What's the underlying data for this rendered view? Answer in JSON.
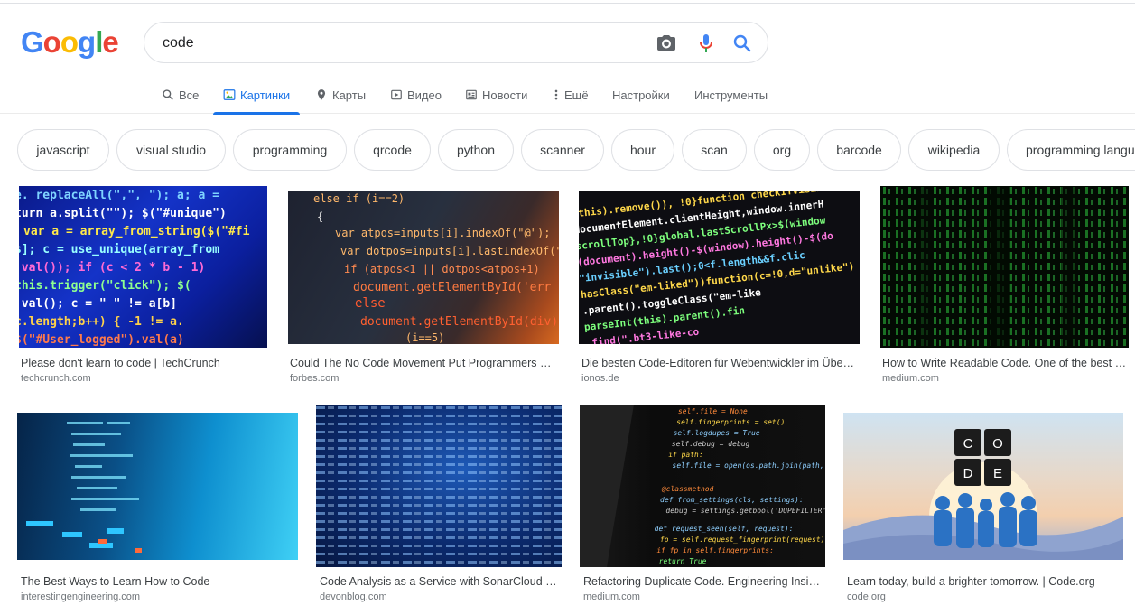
{
  "logo": {
    "letters": [
      "G",
      "o",
      "o",
      "g",
      "l",
      "e"
    ],
    "colors": [
      "#4285F4",
      "#EA4335",
      "#FBBC05",
      "#4285F4",
      "#34A853",
      "#EA4335"
    ]
  },
  "search": {
    "query": "code"
  },
  "tabs": [
    {
      "label": "Все",
      "icon": "search-icon"
    },
    {
      "label": "Картинки",
      "icon": "image-icon",
      "active": true
    },
    {
      "label": "Карты",
      "icon": "map-pin-icon"
    },
    {
      "label": "Видео",
      "icon": "video-icon"
    },
    {
      "label": "Новости",
      "icon": "news-icon"
    },
    {
      "label": "Ещё",
      "icon": "more-vert-icon"
    },
    {
      "label": "Настройки"
    },
    {
      "label": "Инструменты"
    }
  ],
  "chips": [
    "javascript",
    "visual studio",
    "programming",
    "qrcode",
    "python",
    "scanner",
    "hour",
    "scan",
    "org",
    "barcode",
    "wikipedia",
    "programming langu"
  ],
  "results": [
    {
      "title": "Please don't learn to code | TechCrunch",
      "source": "techcrunch.com"
    },
    {
      "title": "Could The No Code Movement Put Programmers Ou...",
      "source": "forbes.com"
    },
    {
      "title": "Die besten Code-Editoren für Webentwickler im Überb...",
      "source": "ionos.de"
    },
    {
      "title": "How to Write Readable Code. One of the best cl...",
      "source": "medium.com"
    },
    {
      "title": "The Best Ways to Learn How to Code",
      "source": "interestingengineering.com"
    },
    {
      "title": "Code Analysis as a Service with SonarCloud - ...",
      "source": "devonblog.com"
    },
    {
      "title": "Refactoring Duplicate Code. Engineering Insig...",
      "source": "medium.com"
    },
    {
      "title": "Learn today, build a brighter tomorrow. | Code.org",
      "source": "code.org"
    }
  ],
  "thumb_text": {
    "r2": [
      "else if (i==2)",
      "{",
      "var atpos=inputs[i].indexOf(\"@\");",
      "var dotpos=inputs[i].lastIndexOf(\".\");",
      "if (atpos<1 || dotpos<atpos+1)",
      "document.getElementById('err",
      "else",
      "document.getElementById(div)",
      "(i==5)"
    ],
    "r8": [
      "C",
      "O",
      "D",
      "E"
    ]
  }
}
